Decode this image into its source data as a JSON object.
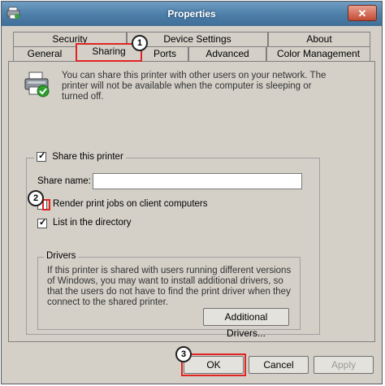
{
  "window": {
    "title": "Properties"
  },
  "tabs_row1": [
    {
      "label": "Security"
    },
    {
      "label": "Device Settings"
    },
    {
      "label": "About"
    }
  ],
  "tabs_row2": [
    {
      "label": "General"
    },
    {
      "label": "Sharing"
    },
    {
      "label": "Ports"
    },
    {
      "label": "Advanced"
    },
    {
      "label": "Color Management"
    }
  ],
  "sharing": {
    "info": "You can share this printer with other users on your network. The printer will not be available when the computer is sleeping or turned off.",
    "share_this_printer": "Share this printer",
    "share_name_label": "Share name:",
    "share_name_value": "",
    "render_jobs": "Render print jobs on client computers",
    "list_in_directory": "List in the directory",
    "drivers_legend": "Drivers",
    "drivers_text": "If this printer is shared with users running different versions of Windows, you may want to install additional drivers, so that the users do not have to find the print driver when they connect to the shared printer.",
    "additional_drivers_button": "Additional Drivers..."
  },
  "buttons": {
    "ok": "OK",
    "cancel": "Cancel",
    "apply": "Apply"
  },
  "callouts": [
    "1",
    "2",
    "3"
  ],
  "colors": {
    "callout_red": "#e02424",
    "titlebar": "#4d7ea8"
  }
}
